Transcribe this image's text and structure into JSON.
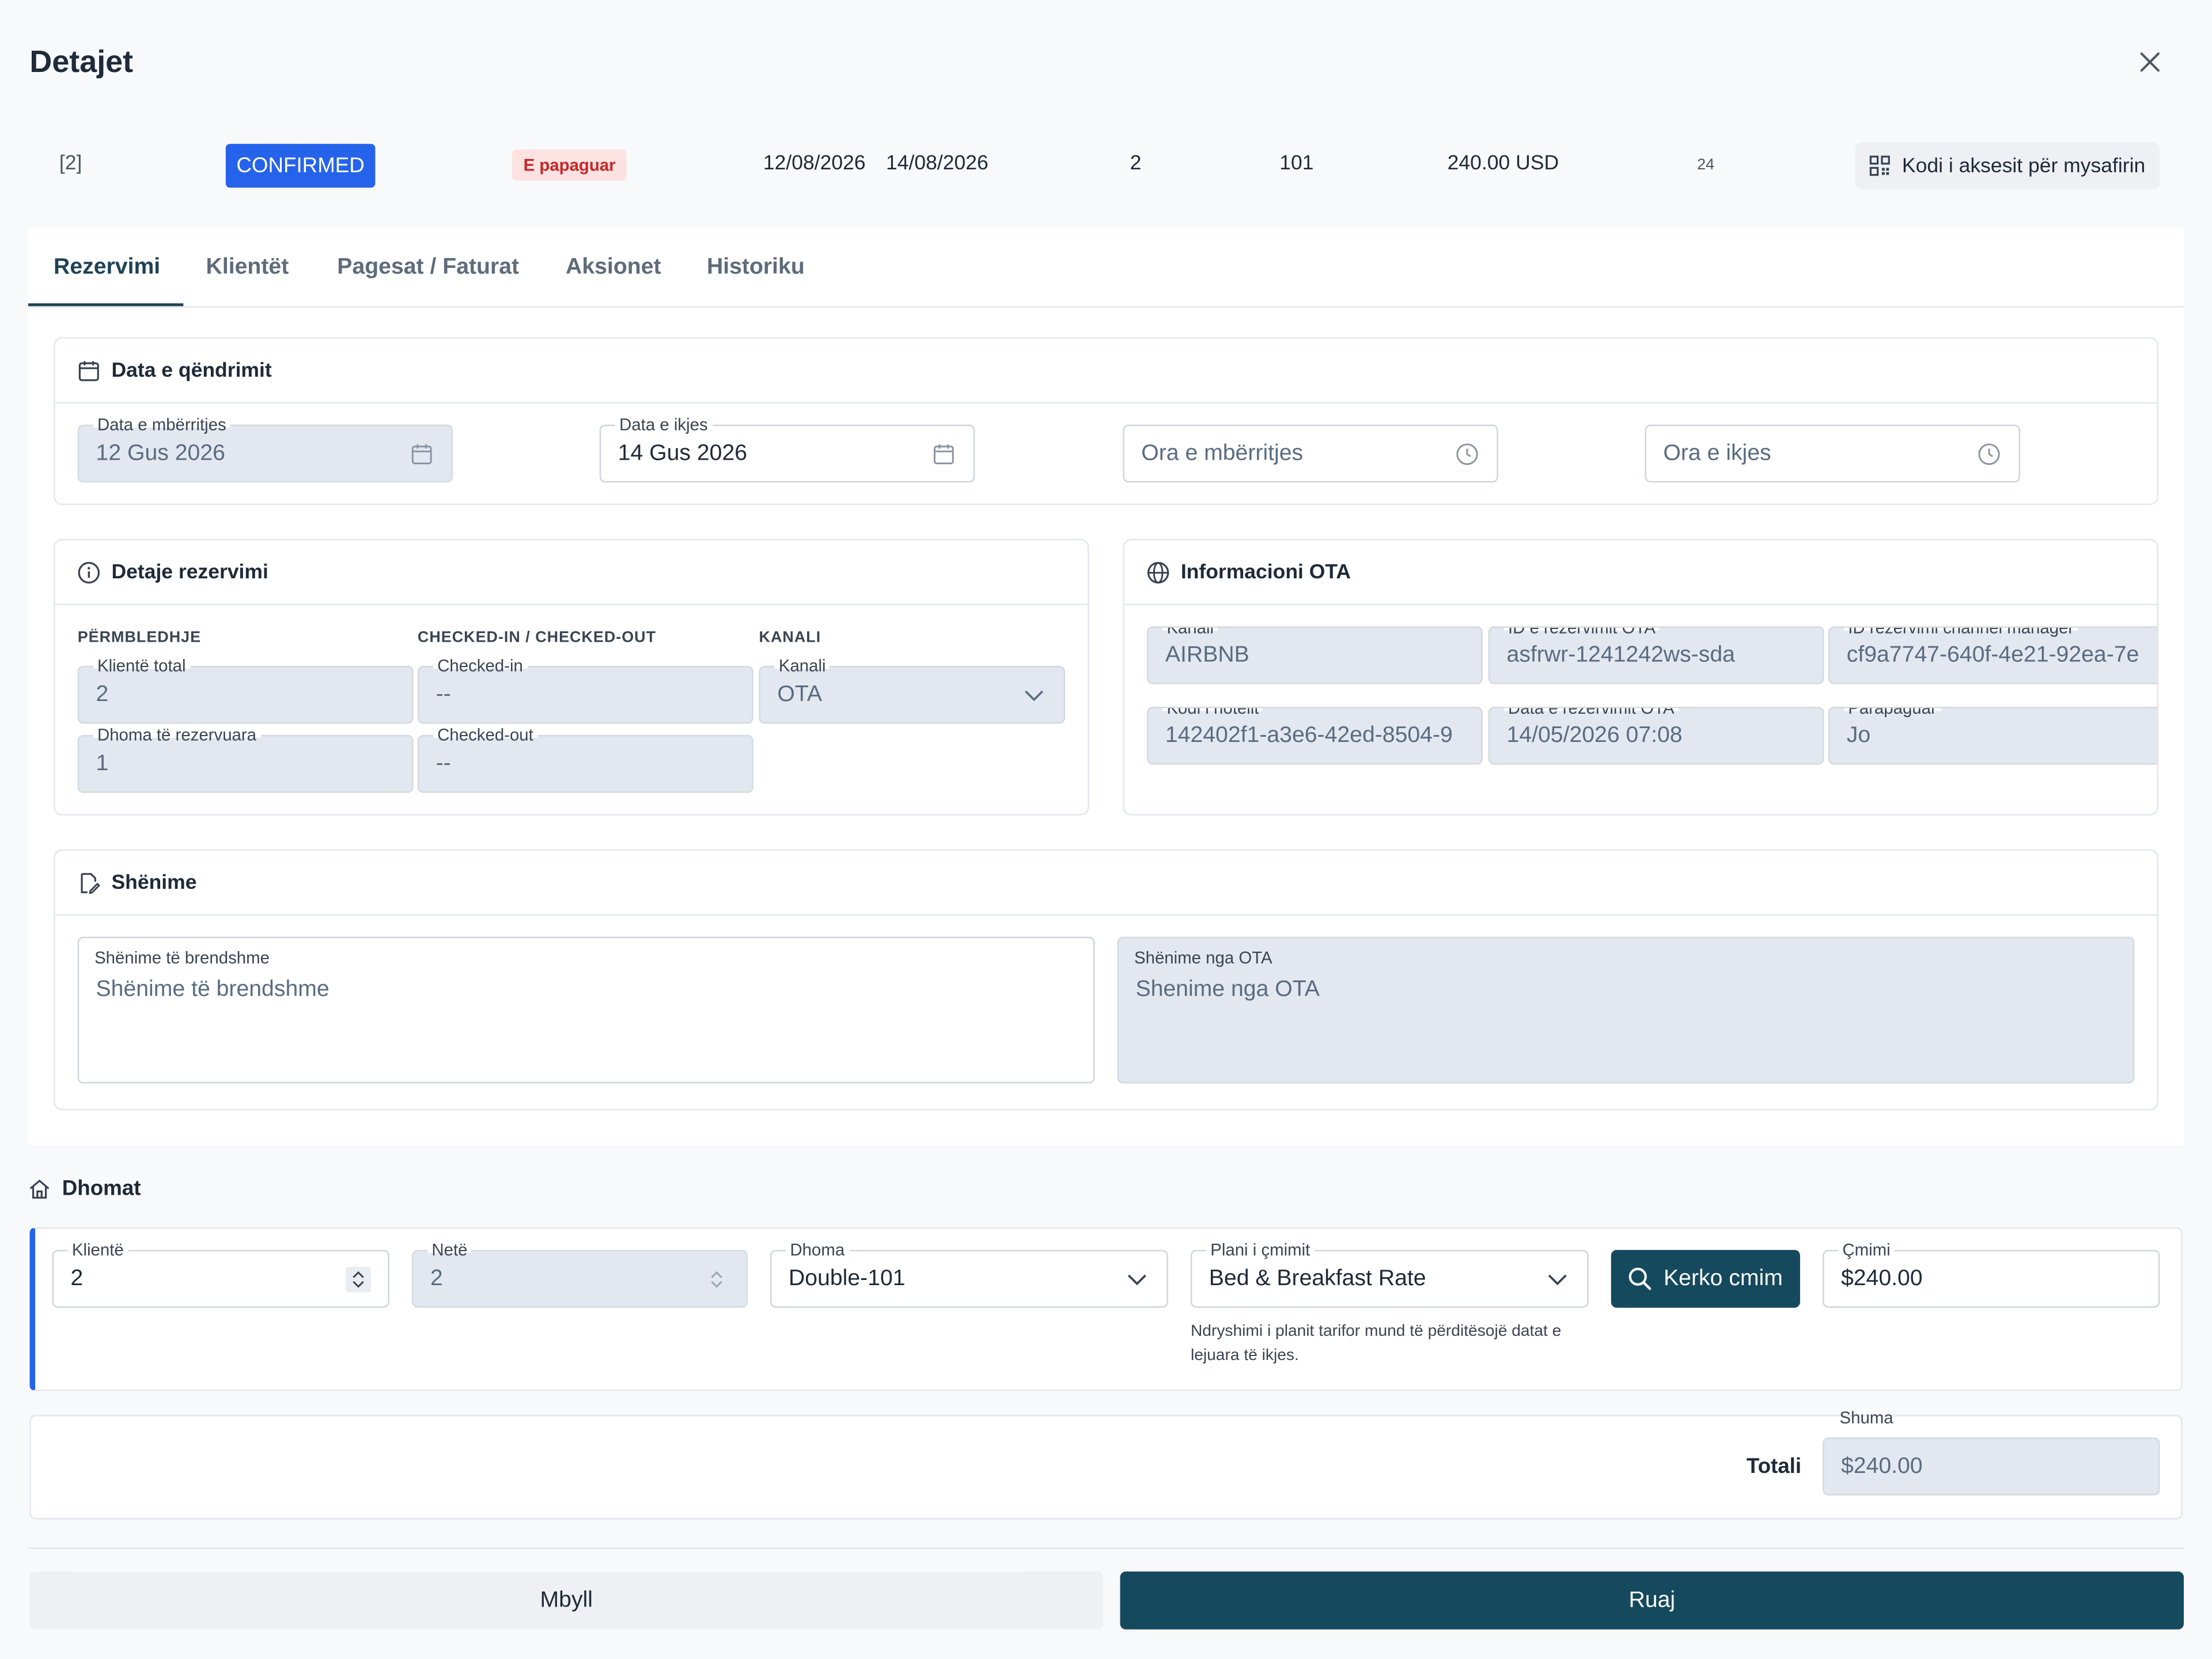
{
  "modal": {
    "title": "Detajet"
  },
  "summary": {
    "ref": "[2]",
    "status": "CONFIRMED",
    "payment_status": "E papaguar",
    "arrival": "12/08/2026",
    "departure": "14/08/2026",
    "nights": "2",
    "room": "101",
    "amount": "240.00 USD",
    "small_value": "24",
    "access_button": "Kodi i aksesit për mysafirin"
  },
  "tabs": [
    "Rezervimi",
    "Klientët",
    "Pagesat / Faturat",
    "Aksionet",
    "Historiku"
  ],
  "stay": {
    "title": "Data e qëndrimit",
    "arrival_label": "Data e mbërritjes",
    "arrival_value": "12 Gus 2026",
    "departure_label": "Data e ikjes",
    "departure_value": "14 Gus 2026",
    "arrival_time_placeholder": "Ora e mbërritjes",
    "departure_time_placeholder": "Ora e ikjes"
  },
  "details": {
    "title": "Detaje rezervimi",
    "group_summary": "PËRMBLEDHJE",
    "group_checkin": "CHECKED-IN / CHECKED-OUT",
    "group_channel": "KANALI",
    "total_clients_label": "Klientë total",
    "total_clients_value": "2",
    "rooms_booked_label": "Dhoma të rezervuara",
    "rooms_booked_value": "1",
    "checked_in_label": "Checked-in",
    "checked_in_value": "--",
    "checked_out_label": "Checked-out",
    "checked_out_value": "--",
    "channel_label": "Kanali",
    "channel_value": "OTA"
  },
  "ota": {
    "title": "Informacioni OTA",
    "channel_label": "Kanali",
    "channel_value": "AIRBNB",
    "ota_id_label": "ID e rezervimit OTA",
    "ota_id_value": "asfrwr-1241242ws-sda",
    "cm_id_label": "ID rezervimi channel manager",
    "cm_id_value": "cf9a7747-640f-4e21-92ea-7e",
    "hotel_code_label": "Kodi i hotelit",
    "hotel_code_value": "142402f1-a3e6-42ed-8504-9",
    "booking_date_label": "Data e rezervimit OTA",
    "booking_date_value": "14/05/2026 07:08",
    "prepaid_label": "Parapaguar",
    "prepaid_value": "Jo"
  },
  "notes": {
    "title": "Shënime",
    "internal_label": "Shënime të brendshme",
    "internal_placeholder": "Shënime të brendshme",
    "ota_label": "Shënime nga OTA",
    "ota_value": "Shenime nga OTA"
  },
  "rooms": {
    "title": "Dhomat",
    "clients_label": "Klientë",
    "clients_value": "2",
    "nights_label": "Netë",
    "nights_value": "2",
    "room_label": "Dhoma",
    "room_value": "Double-101",
    "rate_label": "Plani i çmimit",
    "rate_value": "Bed & Breakfast Rate",
    "search_button": "Kerko cmim",
    "price_label": "Çmimi",
    "price_value": "$240.00",
    "hint": "Ndryshimi i planit tarifor mund të përditësojë datat e lejuara të ikjes."
  },
  "total": {
    "label": "Totali",
    "sum_label": "Shuma",
    "sum_value": "$240.00"
  },
  "footer": {
    "close": "Mbyll",
    "save": "Ruaj"
  },
  "colors": {
    "primary": "#15495e",
    "confirmed": "#2563eb",
    "unpaid_bg": "#fde2e2",
    "unpaid_text": "#c62828"
  }
}
